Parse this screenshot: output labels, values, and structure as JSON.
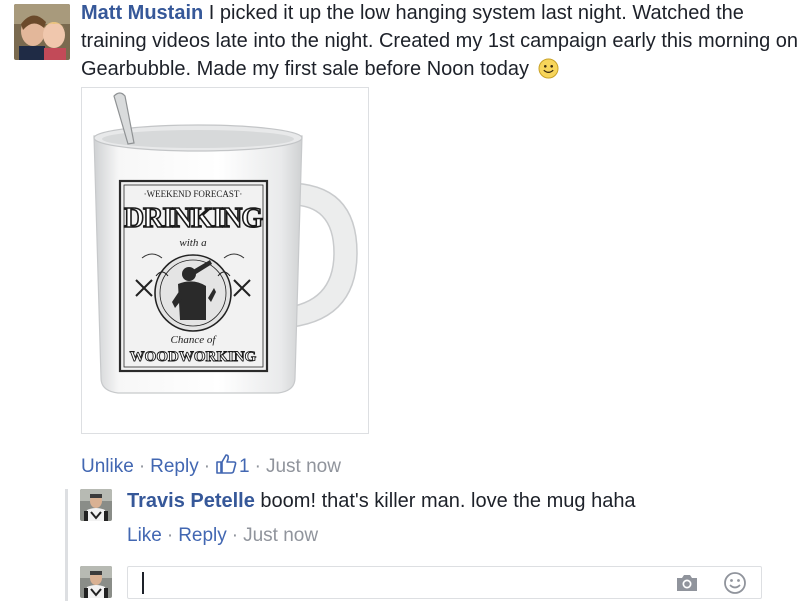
{
  "comment": {
    "author": "Matt Mustain",
    "text": " I picked it up the low hanging system last night. Watched the training videos late into the night. Created my 1st campaign early this morning on Gearbubble. Made my first sale before Noon today",
    "emoji": "smile-icon",
    "attachment": {
      "top_line": "·WEEKEND FORECAST·",
      "headline": "DRINKING",
      "with": "with a",
      "chance": "Chance of",
      "bottom": "WOODWORKING"
    },
    "actions": {
      "unlike": "Unlike",
      "reply": "Reply",
      "like_count": "1",
      "time": "Just now"
    }
  },
  "reply": {
    "author": "Travis Petelle",
    "text": " boom! that's killer man. love the mug haha",
    "actions": {
      "like": "Like",
      "reply": "Reply",
      "time": "Just now"
    }
  },
  "composer": {
    "value": "",
    "camera_icon": "camera-icon",
    "emoji_icon": "emoji-icon"
  },
  "colors": {
    "link": "#4267b2",
    "author": "#365899",
    "meta": "#90949c"
  }
}
